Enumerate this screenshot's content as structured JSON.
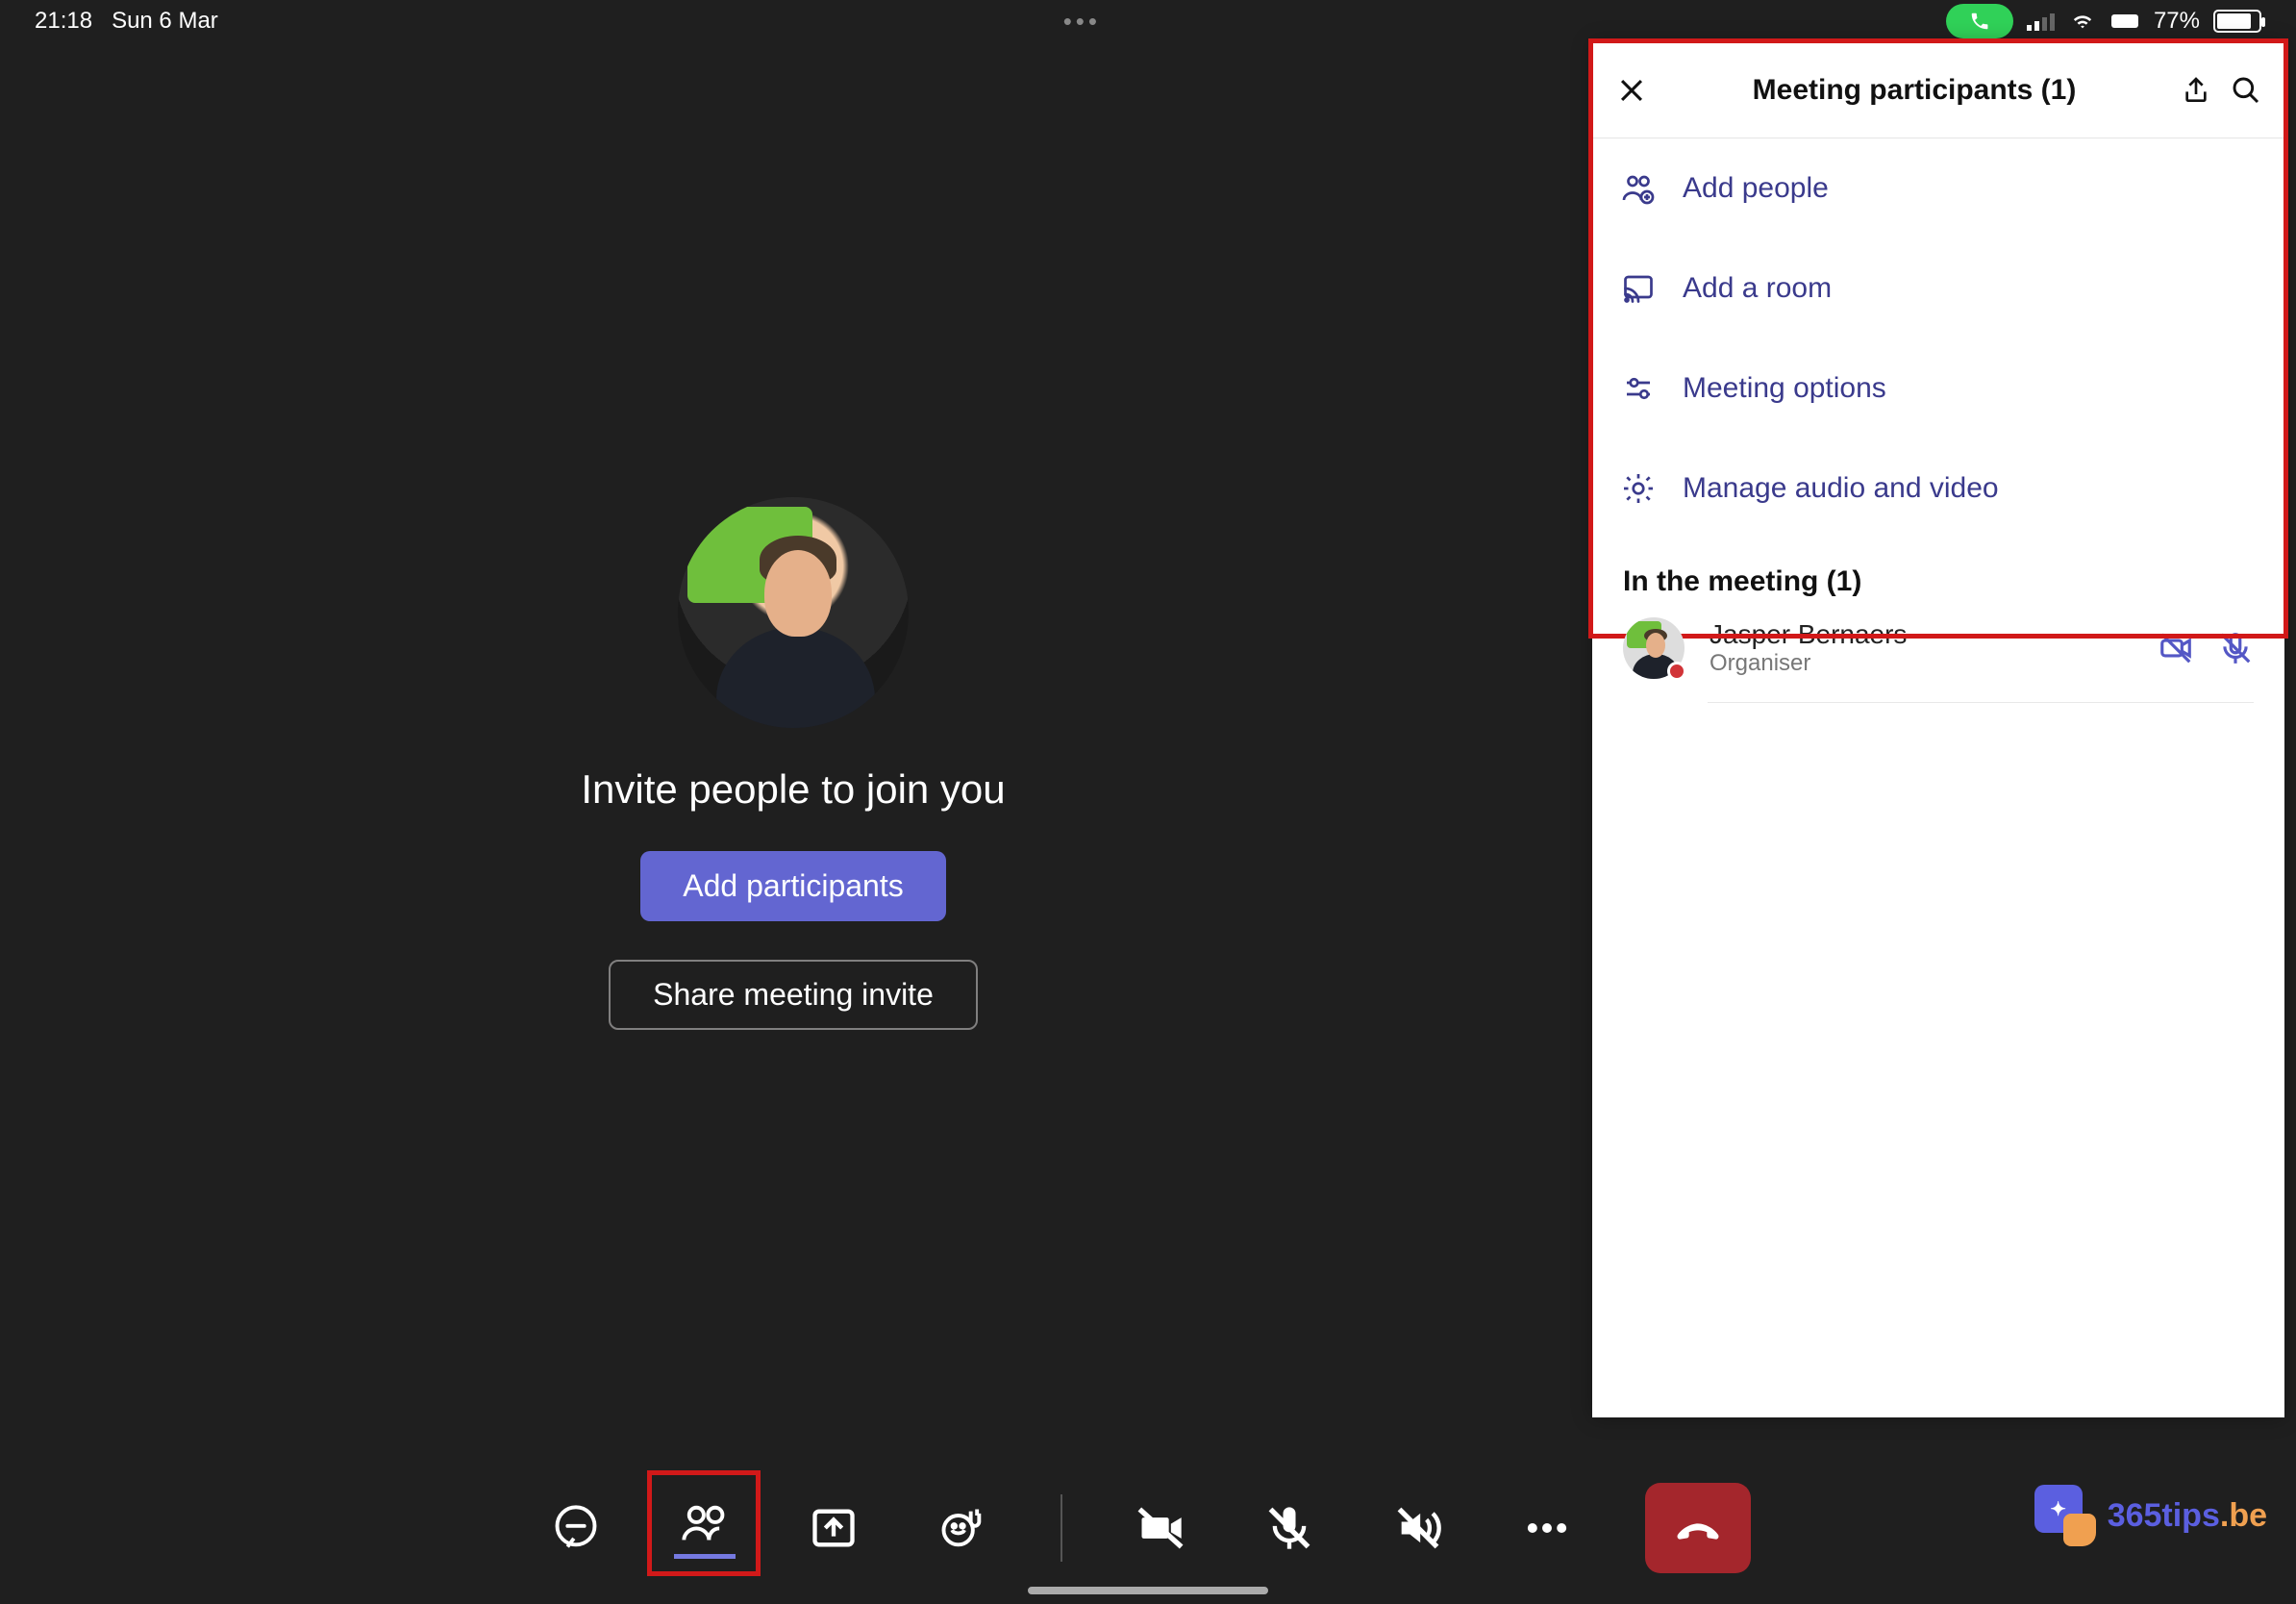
{
  "status_bar": {
    "time": "21:18",
    "date": "Sun 6 Mar",
    "battery_percent": "77%"
  },
  "main": {
    "invite_title": "Invite people to join you",
    "add_participants_label": "Add participants",
    "share_invite_label": "Share meeting invite"
  },
  "panel": {
    "title": "Meeting participants (1)",
    "actions": {
      "add_people": "Add people",
      "add_a_room": "Add a room",
      "meeting_options": "Meeting options",
      "manage_av": "Manage audio and video"
    },
    "section_title": "In the meeting (1)",
    "participants": [
      {
        "name": "Jasper Bernaers",
        "role": "Organiser"
      }
    ]
  },
  "watermark": {
    "brand": "365tips",
    "tld": ".be"
  }
}
